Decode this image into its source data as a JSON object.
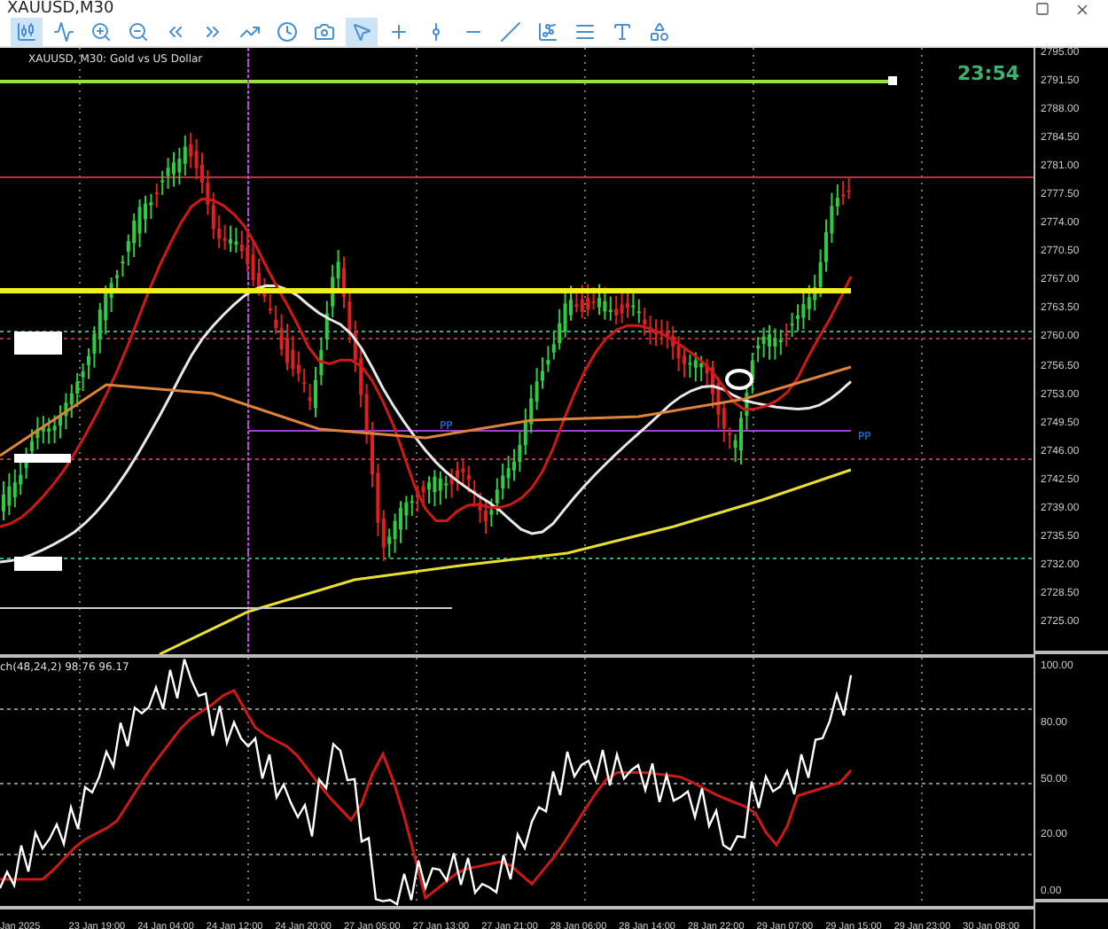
{
  "window": {
    "title": "XAUUSD,M30"
  },
  "toolbar": [
    {
      "kind": "candles",
      "selected": true
    },
    {
      "kind": "line",
      "selected": false
    },
    {
      "kind": "zoom-in",
      "selected": false
    },
    {
      "kind": "zoom-out",
      "selected": false
    },
    {
      "kind": "scroll",
      "selected": false
    },
    {
      "kind": "autoscroll",
      "selected": false
    },
    {
      "kind": "indicators",
      "selected": false
    },
    {
      "kind": "periods",
      "selected": false
    },
    {
      "kind": "screenshot",
      "selected": false
    },
    {
      "kind": "cursor",
      "selected": true
    },
    {
      "kind": "crosshair",
      "selected": false
    },
    {
      "kind": "vline",
      "selected": false
    },
    {
      "kind": "hline",
      "selected": false
    },
    {
      "kind": "trendline",
      "selected": false
    },
    {
      "kind": "channel",
      "selected": false
    },
    {
      "kind": "fibo",
      "selected": false
    },
    {
      "kind": "text",
      "selected": false
    },
    {
      "kind": "shapes",
      "selected": false
    }
  ],
  "chart": {
    "label": "XAUUSD, M30:  Gold vs US Dollar",
    "timer": "23:54",
    "pivot_labels": [
      "PP",
      "PP"
    ],
    "price_axis": [
      "2795.00",
      "2791.50",
      "2788.00",
      "2784.50",
      "2781.00",
      "2777.50",
      "2774.00",
      "2770.50",
      "2767.00",
      "2763.50",
      "2760.00",
      "2756.50",
      "2753.00",
      "2749.50",
      "2746.00",
      "2742.50",
      "2739.00",
      "2735.50",
      "2732.00",
      "2728.50",
      "2725.00"
    ]
  },
  "oscillator": {
    "label": "ch(48,24,2) 98.76 96.17",
    "axis": [
      "100.00",
      "80.00",
      "50.00",
      "20.00",
      "0.00"
    ]
  },
  "time_axis": [
    "Jan 2025",
    "23 Jan 19:00",
    "24 Jan 04:00",
    "24 Jan 12:00",
    "24 Jan 20:00",
    "27 Jan 05:00",
    "27 Jan 13:00",
    "27 Jan 21:00",
    "28 Jan 06:00",
    "28 Jan 14:00",
    "28 Jan 22:00",
    "29 Jan 07:00",
    "29 Jan 15:00",
    "29 Jan 23:00",
    "30 Jan 08:00"
  ]
}
